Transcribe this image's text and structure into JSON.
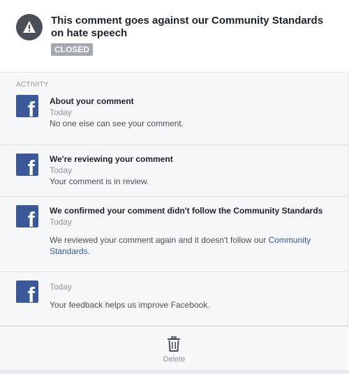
{
  "header": {
    "title": "This comment goes against our Community Standards on hate speech",
    "status_badge": "CLOSED"
  },
  "activity": {
    "label": "ACTIVITY",
    "items": [
      {
        "icon": "facebook-icon",
        "title": "About your comment",
        "time": "Today",
        "body": "No one else can see your comment."
      },
      {
        "icon": "facebook-icon",
        "title": "We're reviewing your comment",
        "time": "Today",
        "body": "Your comment is in review."
      },
      {
        "icon": "facebook-icon",
        "title": "We confirmed your comment didn't follow the Community Standards",
        "time": "Today",
        "body_prefix": "We reviewed your comment again and it doesn't follow our ",
        "body_link": "Community Standards",
        "body_suffix": "."
      },
      {
        "icon": "facebook-icon",
        "time": "Today",
        "body": "Your feedback helps us improve Facebook."
      }
    ]
  },
  "footer": {
    "delete_label": "Delete",
    "delete_icon": "trash-icon"
  },
  "colors": {
    "facebook_blue": "#3b5998",
    "link": "#365899",
    "badge": "#a5a8ad"
  }
}
